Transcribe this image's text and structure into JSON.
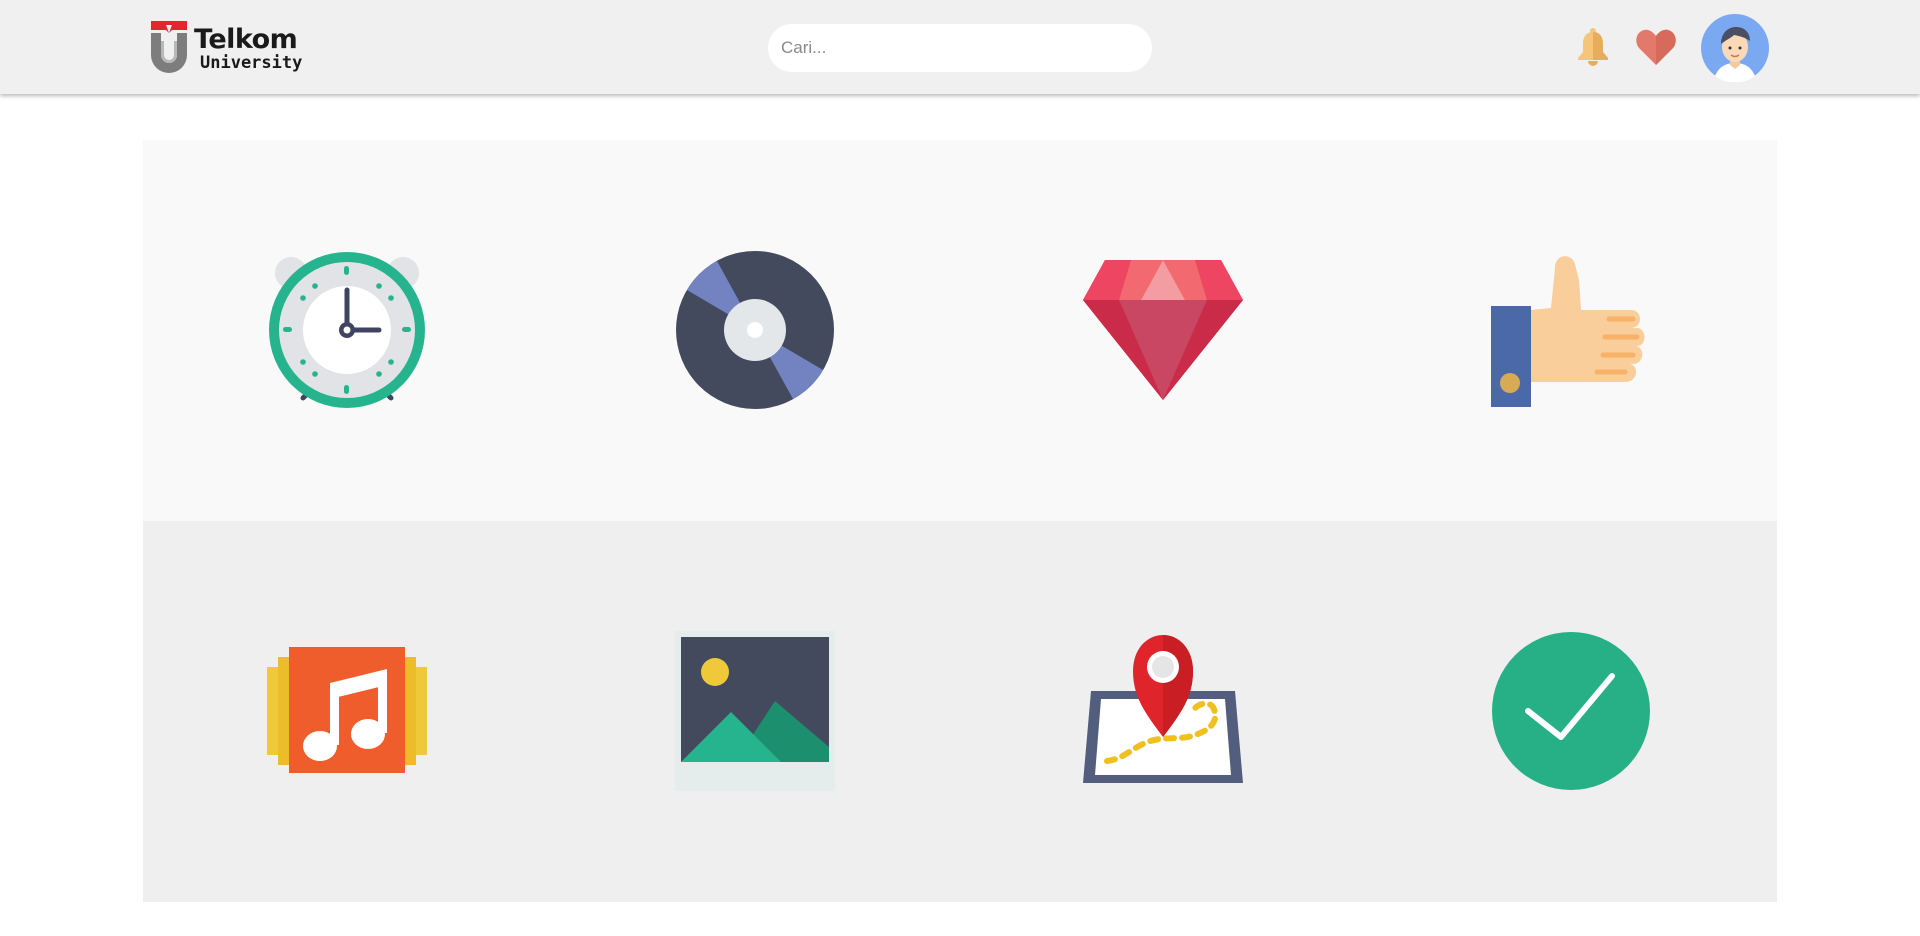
{
  "header": {
    "logo": {
      "line1": "Telkom",
      "line2": "University"
    },
    "search": {
      "placeholder": "Cari...",
      "value": ""
    },
    "icons": [
      "bell-icon",
      "heart-icon",
      "user-avatar"
    ]
  },
  "grid": {
    "rows": [
      {
        "tiles": [
          "alarm-clock",
          "vinyl-disc",
          "ruby-gem",
          "thumbs-up"
        ]
      },
      {
        "tiles": [
          "music-album",
          "image-picture",
          "map-location-pin",
          "check-mark"
        ]
      }
    ]
  },
  "colors": {
    "header_bg": "#f0f0f0",
    "row1_bg": "#f9f9f9",
    "row2_bg": "#efefef",
    "logo_red": "#e32530",
    "bell": "#f5c57a",
    "heart": "#e2796b",
    "avatar_bg": "#7aa9f2"
  }
}
